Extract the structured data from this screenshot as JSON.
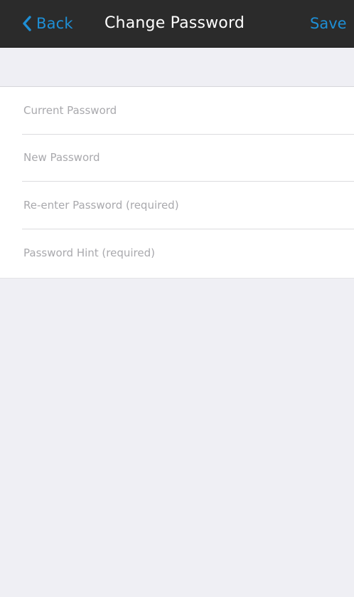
{
  "nav": {
    "back_label": "Back",
    "title": "Change Password",
    "save_label": "Save"
  },
  "form": {
    "fields": [
      {
        "placeholder": "Current Password",
        "value": ""
      },
      {
        "placeholder": "New Password",
        "value": ""
      },
      {
        "placeholder": "Re-enter Password (required)",
        "value": ""
      },
      {
        "placeholder": "Password Hint (required)",
        "value": ""
      }
    ]
  },
  "colors": {
    "nav_background": "#2b2b2b",
    "accent": "#1e8fd6",
    "page_background": "#efeff4",
    "placeholder_text": "#a9a9ad"
  },
  "icons": {
    "back": "chevron-left-icon"
  }
}
